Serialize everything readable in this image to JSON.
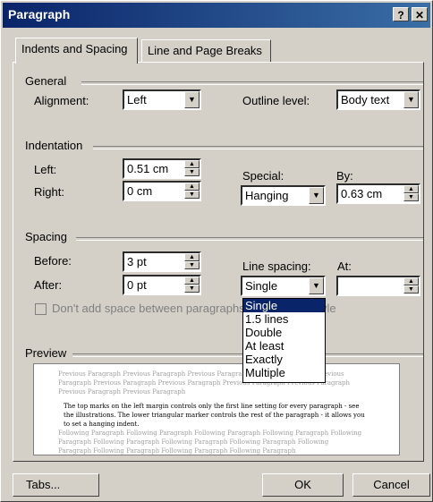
{
  "window": {
    "title": "Paragraph",
    "help_label": "?",
    "close_label": "✕"
  },
  "tabs": {
    "indents_label": "Indents and Spacing",
    "breaks_label": "Line and Page Breaks"
  },
  "general": {
    "group_label": "General",
    "alignment_label": "Alignment:",
    "alignment_value": "Left",
    "outline_label": "Outline level:",
    "outline_value": "Body text"
  },
  "indentation": {
    "group_label": "Indentation",
    "left_label": "Left:",
    "left_value": "0.51 cm",
    "right_label": "Right:",
    "right_value": "0 cm",
    "special_label": "Special:",
    "special_value": "Hanging",
    "by_label": "By:",
    "by_value": "0.63 cm"
  },
  "spacing": {
    "group_label": "Spacing",
    "before_label": "Before:",
    "before_value": "3 pt",
    "after_label": "After:",
    "after_value": "0 pt",
    "line_spacing_label": "Line spacing:",
    "line_spacing_value": "Single",
    "at_label": "At:",
    "at_value": "",
    "dont_add_label": "Don't add space between paragraphs of the same style",
    "line_spacing_options": [
      "Single",
      "1.5 lines",
      "Double",
      "At least",
      "Exactly",
      "Multiple"
    ],
    "selected_option": "Single"
  },
  "preview": {
    "group_label": "Preview",
    "prev_text": "Previous Paragraph Previous Paragraph Previous Paragraph Previous Paragraph Previous Paragraph Previous Paragraph Previous Paragraph Previous Paragraph Previous Paragraph Previous Paragraph Previous Paragraph",
    "main_text": "The top marks on the left margin controls only the first line setting for every paragraph - see the illustrations. The lower triangular marker controls the rest of the paragraph - it allows you to set a hanging indent.",
    "following_text": "Following Paragraph Following Paragraph Following Paragraph Following Paragraph Following Paragraph Following Paragraph Following Paragraph Following Paragraph Following Paragraph Following Paragraph Following Paragraph Following Paragraph"
  },
  "buttons": {
    "tabs_label": "Tabs...",
    "ok_label": "OK",
    "cancel_label": "Cancel"
  }
}
